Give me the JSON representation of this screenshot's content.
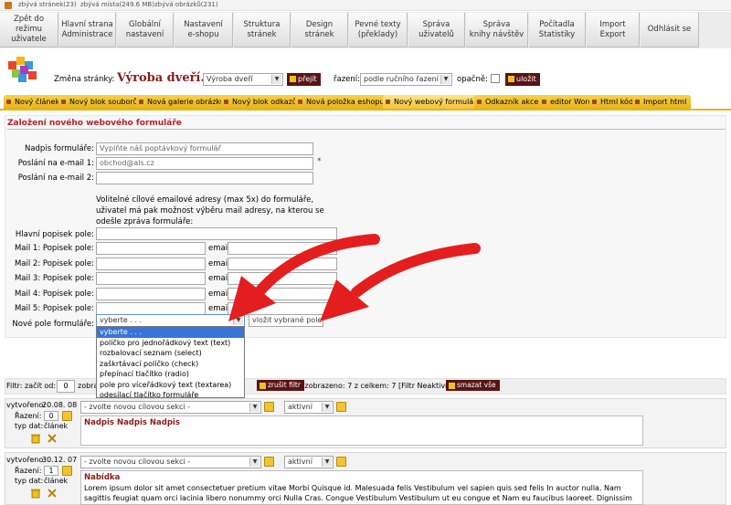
{
  "topstrip": {
    "pages_left": "zbývá stránek(23)",
    "space_left": "zbývá místa(249.6 MB)",
    "images_left": "zbývá obrázků(231)"
  },
  "mainnav": [
    "Zpět do režimu\nuživatele",
    "Hlavní strana\nAdministrace",
    "Globální\nnastavení",
    "Nastavení\ne-shopu",
    "Struktura\nstránek",
    "Design\nstránek",
    "Pevné texty\n(překlady)",
    "Správa\nuživatelů",
    "Správa\nknihy návštěv",
    "Počítadla\nStatistiky",
    "Import\nExport",
    "Odhlásit se"
  ],
  "pagebar": {
    "change_label": "Změna stránky:",
    "page_title": "Výroba dveří...",
    "page_select": "Výroba dveří",
    "go_button": "přejít",
    "sort_label": "řazení:",
    "sort_select": "podle ručního řazení",
    "reverse_label": "opačně:",
    "save_button": "uložit"
  },
  "tabs": [
    "Nový článek",
    "Nový blok souborů",
    "Nová galerie obrázků",
    "Nový blok odkazů",
    "Nová položka eshopu",
    "Nový webový formulář",
    "Odkazník akce",
    "editor Word",
    "Html kód",
    "Import html"
  ],
  "form": {
    "title": "Založení nového webového formuláře",
    "heading_label": "Nadpis formuláře:",
    "heading_value": "Vyplňte náš poptávkový formulář",
    "email1_label": "Poslání na e-mail 1:",
    "email1_value": "obchod@als.cz",
    "required_mark": "*",
    "email2_label": "Poslání na e-mail 2:",
    "note": "Volitelné cílové emailové adresy (max 5x) do formuláře, uživatel má pak možnost výběru mail adresy, na kterou se odešle zpráva formuláře:",
    "main_desc_label": "Hlavní popisek pole:",
    "mail_rows": [
      {
        "label": "Mail 1: Popisek pole:",
        "email_label": "email:"
      },
      {
        "label": "Mail 2: Popisek pole:",
        "email_label": "email:"
      },
      {
        "label": "Mail 3: Popisek pole:",
        "email_label": "email:"
      },
      {
        "label": "Mail 4: Popisek pole:",
        "email_label": "email:"
      },
      {
        "label": "Mail 5: Popisek pole:",
        "email_label": "email:"
      }
    ],
    "new_field_label": "Nové pole formuláře:",
    "new_field_select": "vyberte . . .",
    "insert_button": "vložit vybrané pole",
    "options": [
      "vyberte . . .",
      "políčko pro jednořádkový text (text)",
      "rozbalovací seznam (select)",
      "zaškrtávací políčko (check)",
      "přepínací tlačítko (radio)",
      "pole pro víceřádkový text (textarea)",
      "odesílací tlačítko formuláře"
    ]
  },
  "filter": {
    "start_label": "Filtr: začít od:",
    "start_value": "0",
    "show_label": "zobra",
    "cancel_button": "zrušit filtr",
    "status": "- zobrazeno: 7 z celkem: 7 [Filtr Neaktivní]",
    "delete_all": "smazat vše"
  },
  "records": [
    {
      "created_label": "vytvořeno:",
      "created": "20.08. 08",
      "order_label": "Řazení:",
      "order": "0",
      "type_label": "typ dat:",
      "type": "článek",
      "section_select": "- zvolte novou cílovou sekci -",
      "status_select": "aktivní",
      "heading": "Nadpis Nadpis Nadpis",
      "text": ""
    },
    {
      "created_label": "vytvořeno:",
      "created": "30.12. 07",
      "order_label": "Řazení:",
      "order": "1",
      "type_label": "typ dat:",
      "type": "článek",
      "section_select": "- zvolte novou cílovou sekci -",
      "status_select": "aktivní",
      "heading": "Nabídka",
      "text": "Lorem ipsum dolor sit amet consectetuer pretium vitae Morbi Quisque id. Malesuada felis Vestibulum vel sapien quis sed felis In auctor nulla. Nam sagittis feugiat quam orci lacinia libero nonummy orci Nulla Cras. Congue Vestibulum Vestibulum ut eu congue et Nam eu faucibus laoreet. Dignissim pellentesque et"
    }
  ],
  "colors": {
    "tab_yellow": "#f8d24a",
    "dark_button": "#5a1313",
    "form_title": "#b3232a",
    "arrow_red": "#e41e1e",
    "dropdown_highlight": "#3875d7"
  }
}
